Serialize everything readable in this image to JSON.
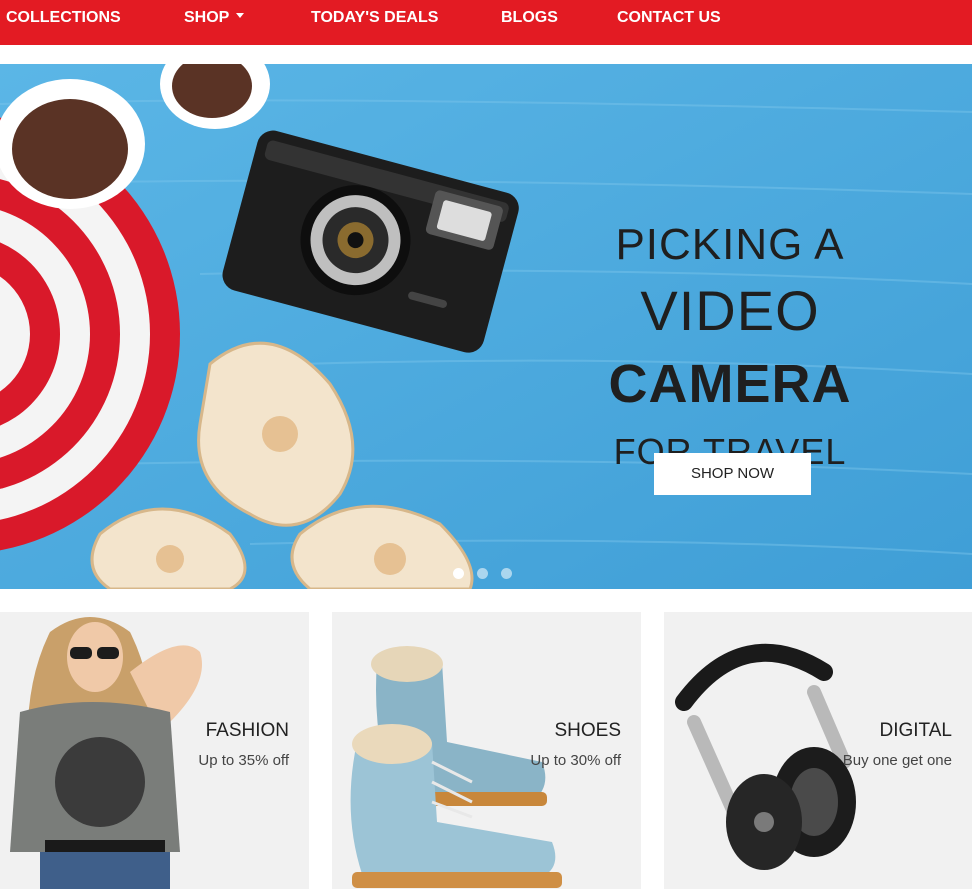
{
  "nav": {
    "items": [
      {
        "label": "COLLECTIONS"
      },
      {
        "label": "SHOP",
        "has_dropdown": true
      },
      {
        "label": "TODAY'S DEALS"
      },
      {
        "label": "BLOGS"
      },
      {
        "label": "CONTACT US"
      }
    ],
    "color": "#e31b23"
  },
  "hero": {
    "line1": "PICKING A",
    "line2": "VIDEO",
    "line3": "CAMERA",
    "line4": "FOR TRAVEL",
    "button_label": "SHOP NOW",
    "slides": 3,
    "active_slide": 1
  },
  "categories": [
    {
      "title": "FASHION",
      "subtitle": "Up to 35% off"
    },
    {
      "title": "SHOES",
      "subtitle": "Up to 30% off"
    },
    {
      "title": "DIGITAL",
      "subtitle": "Buy one get one"
    }
  ]
}
